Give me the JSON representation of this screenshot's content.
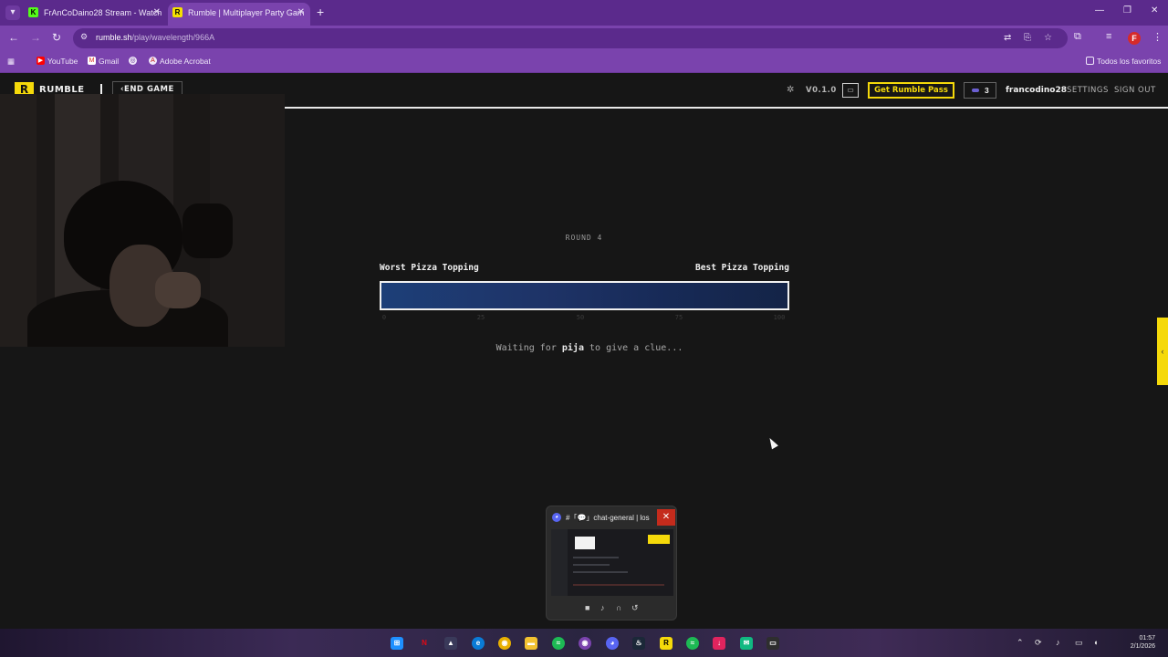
{
  "browser": {
    "tabs": [
      {
        "title": "FrAnCoDaino28 Stream - Watch",
        "favicon": "kick-icon",
        "active": false
      },
      {
        "title": "Rumble | Multiplayer Party Gam",
        "favicon": "rumble-icon",
        "active": true
      }
    ],
    "url_domain": "rumble.sh",
    "url_path": "/play/wavelength/966A",
    "profile_initial": "F",
    "bookmarks": [
      {
        "label": "YouTube",
        "icon": "youtube-icon"
      },
      {
        "label": "Gmail",
        "icon": "gmail-icon"
      },
      {
        "label": "",
        "icon": "globe-icon"
      },
      {
        "label": "Adobe Acrobat",
        "icon": "acrobat-icon"
      }
    ],
    "all_bookmarks_label": "Todos los favoritos"
  },
  "header": {
    "logo_letter": "R",
    "logo_text": "RUMBLE",
    "end_game_label": "END GAME",
    "version": "V0.1.0",
    "rumble_pass_label": "Get Rumble Pass",
    "coins": "3",
    "username": "francodino28",
    "settings_label": "SETTINGS",
    "sign_out_label": "SIGN OUT"
  },
  "game": {
    "round_label": "ROUND 4",
    "left_label": "Worst Pizza Topping",
    "right_label": "Best Pizza Topping",
    "ticks": [
      "0",
      "25",
      "50",
      "75",
      "100"
    ],
    "waiting_prefix": "Waiting for",
    "waiting_player": "pija",
    "waiting_suffix": "to give a clue..."
  },
  "popup": {
    "title": "#「💬」chat-general | los ...",
    "close": "✕"
  },
  "clock": {
    "time": "01:57",
    "date": "2/1/2026"
  },
  "colors": {
    "accent_yellow": "#f5d90a",
    "chrome_purple": "#7a43ad",
    "spectrum_blue": "#1d3f78"
  }
}
